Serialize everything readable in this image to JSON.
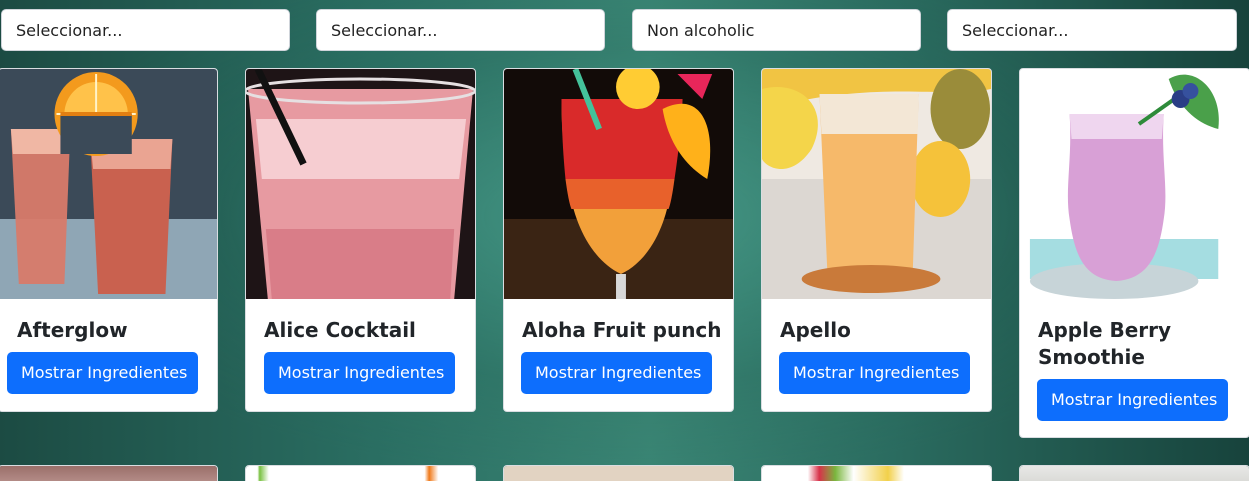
{
  "filters": [
    {
      "value": "Seleccionar..."
    },
    {
      "value": "Seleccionar..."
    },
    {
      "value": "Non alcoholic"
    },
    {
      "value": "Seleccionar..."
    }
  ],
  "cards": [
    {
      "name": "Afterglow",
      "button": "Mostrar Ingredientes"
    },
    {
      "name": "Alice Cocktail",
      "button": "Mostrar Ingredientes"
    },
    {
      "name": "Aloha Fruit punch",
      "button": "Mostrar Ingredientes"
    },
    {
      "name": "Apello",
      "button": "Mostrar Ingredientes"
    },
    {
      "name": "Apple Berry Smoothie",
      "button": "Mostrar Ingredientes"
    }
  ],
  "colors": {
    "primary_button": "#0d6efd",
    "background": "#2a6e62"
  }
}
